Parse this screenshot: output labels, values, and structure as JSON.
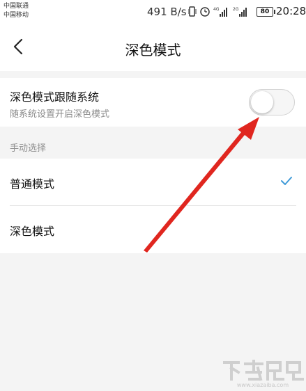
{
  "status_bar": {
    "carrier_1": "中国联通",
    "carrier_2": "中国移动",
    "net_speed": "491 B/s",
    "battery": "80",
    "time": "20:28",
    "icons": [
      "vibrate-icon",
      "alarm-icon",
      "signal-4g-icon",
      "signal-2g-icon",
      "battery-icon"
    ]
  },
  "header": {
    "title": "深色模式",
    "back_icon": "chevron-left-icon"
  },
  "follow_system": {
    "title": "深色模式跟随系统",
    "subtitle": "随系统设置开启深色模式",
    "enabled": false
  },
  "manual": {
    "section_label": "手动选择",
    "options": [
      {
        "label": "普通模式",
        "selected": true
      },
      {
        "label": "深色模式",
        "selected": false
      }
    ]
  },
  "watermark": {
    "text": "www.xiazaiba.com"
  },
  "colors": {
    "accent": "#3f9ad8",
    "annotation_arrow": "#e0261f"
  }
}
